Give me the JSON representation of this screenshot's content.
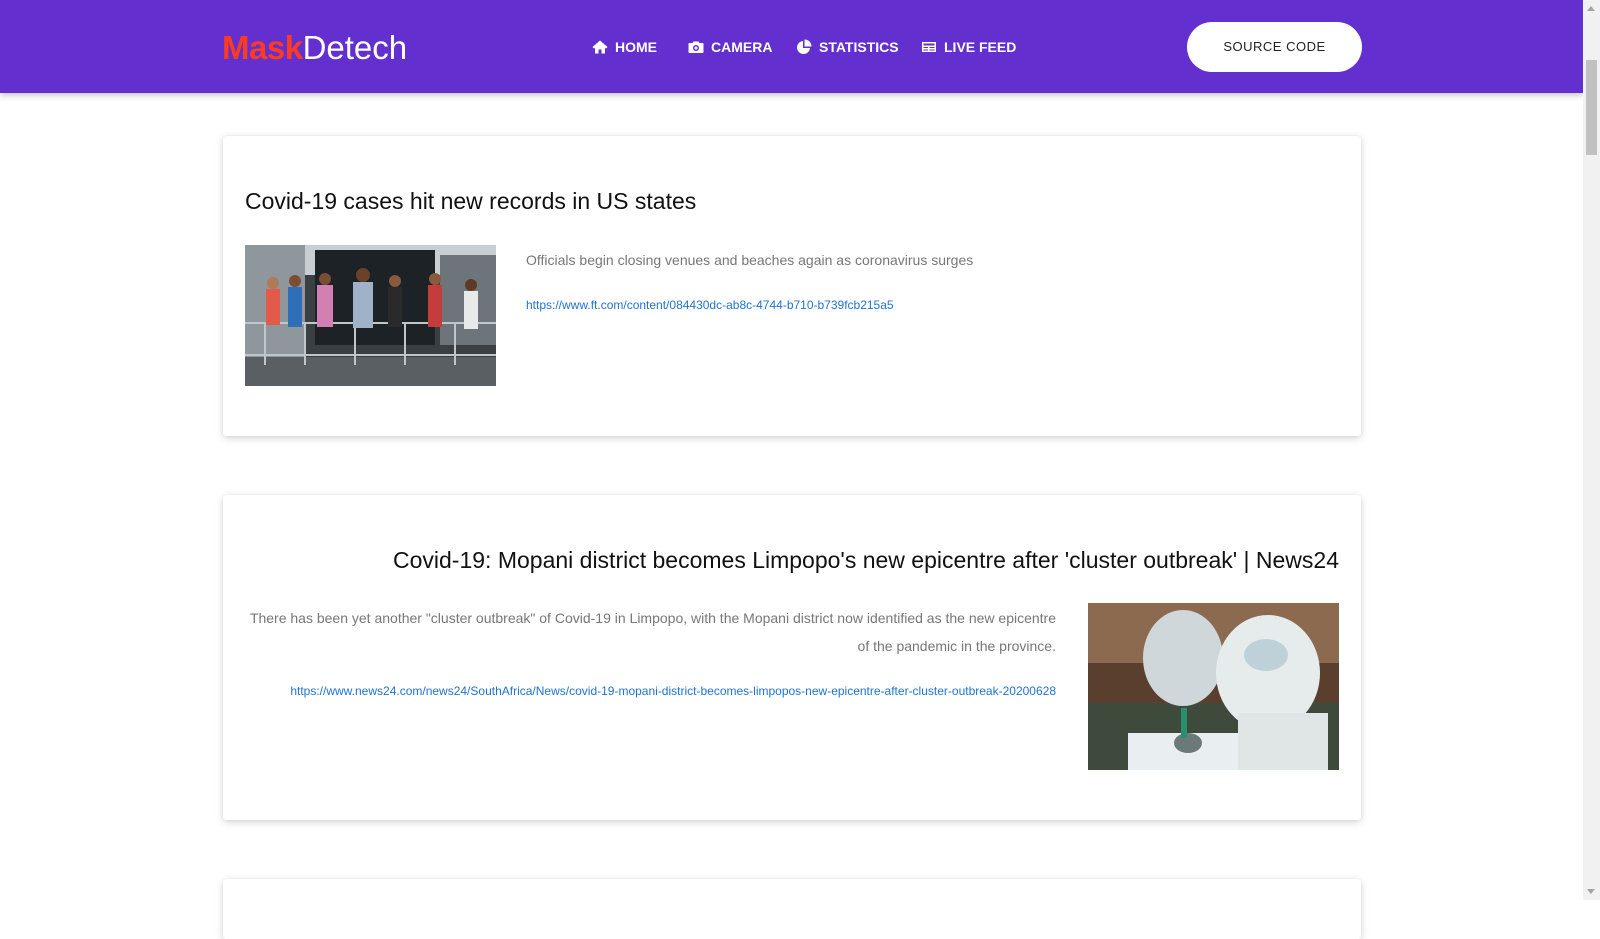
{
  "brand": {
    "part1": "Mask",
    "part2": "Detech"
  },
  "nav": [
    {
      "label": "HOME",
      "icon": "home-icon"
    },
    {
      "label": "CAMERA",
      "icon": "camera-icon"
    },
    {
      "label": "STATISTICS",
      "icon": "pie-chart-icon"
    },
    {
      "label": "LIVE FEED",
      "icon": "newspaper-icon"
    }
  ],
  "source_button": "SOURCE CODE",
  "colors": {
    "navbar": "#6330cf",
    "brand_accent": "#ff3b1f",
    "link": "#1e73d2"
  },
  "articles": [
    {
      "title": "Covid-19 cases hit new records in US states",
      "description": "Officials begin closing venues and beaches again as coronavirus surges",
      "url": "https://www.ft.com/content/084430dc-ab8c-4744-b710-b739fcb215a5"
    },
    {
      "title": "Covid-19: Mopani district becomes Limpopo's new epicentre after 'cluster outbreak' | News24",
      "description": "There has been yet another \"cluster outbreak\" of Covid-19 in Limpopo, with the Mopani district now identified as the new epicentre of the pandemic in the province.",
      "url": "https://www.news24.com/news24/SouthAfrica/News/covid-19-mopani-district-becomes-limpopos-new-epicentre-after-cluster-outbreak-20200628"
    }
  ]
}
